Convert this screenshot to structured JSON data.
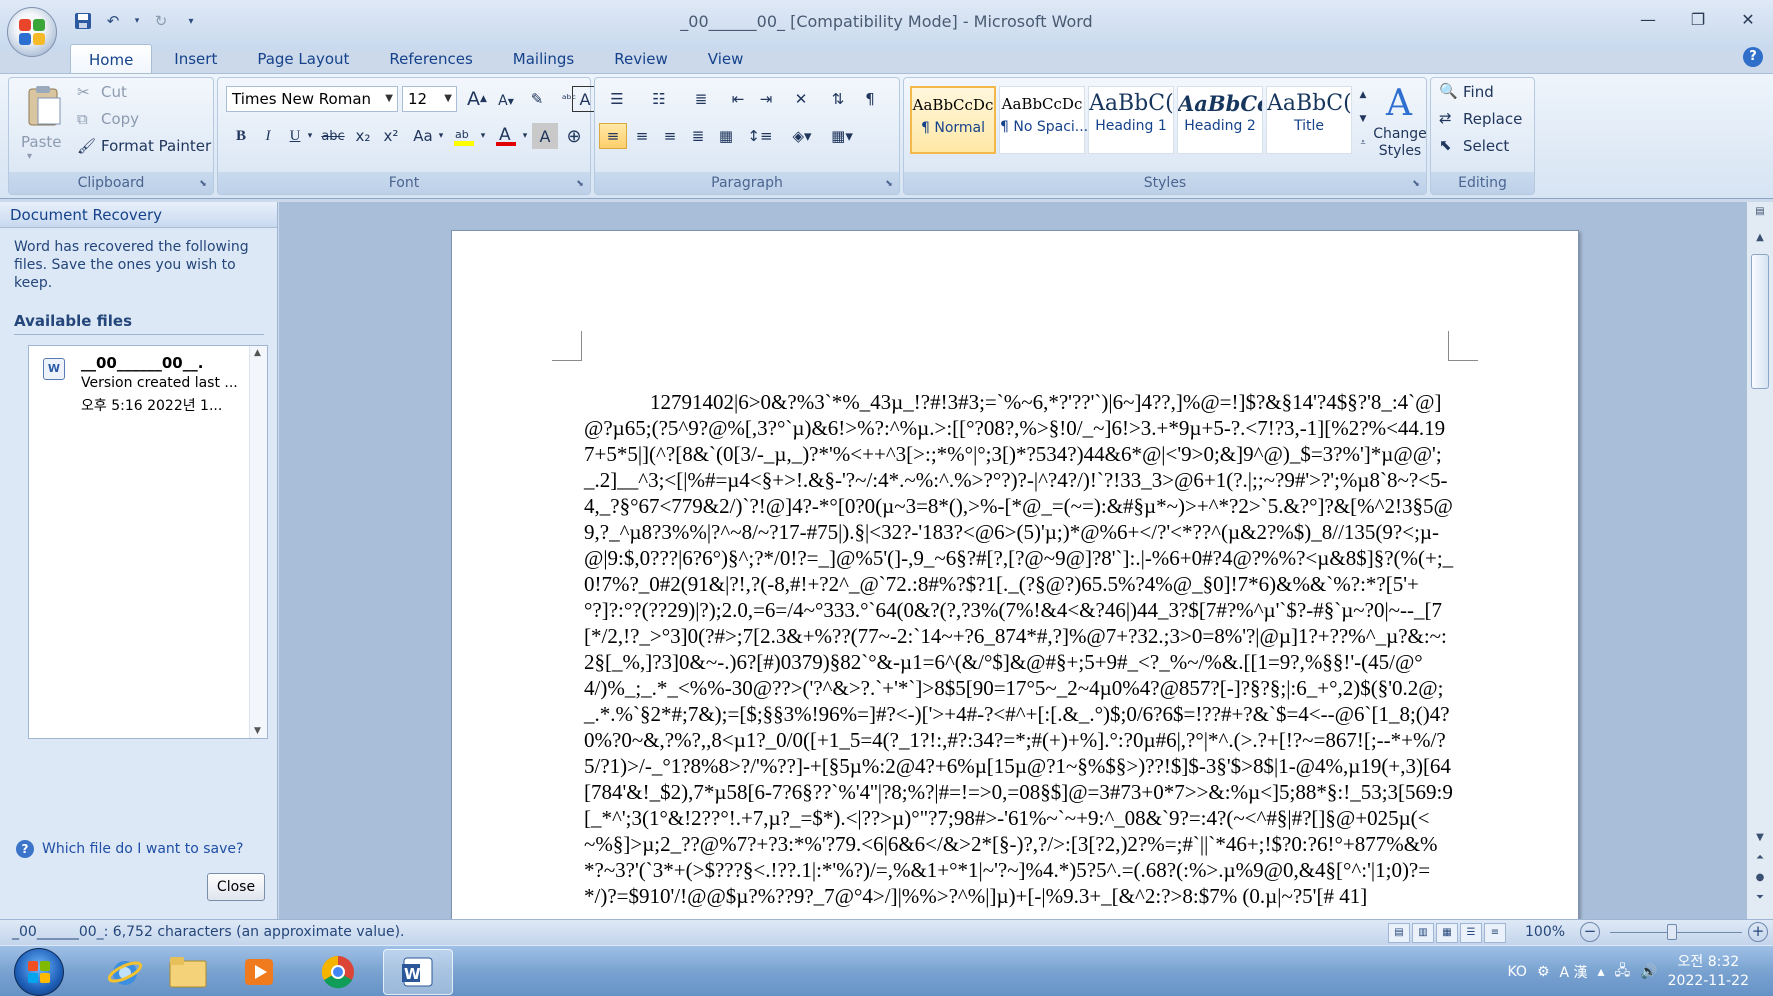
{
  "window": {
    "title": "_00______00_ [Compatibility Mode] - Microsoft Word",
    "min_icon": "minimize-icon",
    "max_icon": "restore-icon",
    "close_icon": "close-icon"
  },
  "tabs": [
    "Home",
    "Insert",
    "Page Layout",
    "References",
    "Mailings",
    "Review",
    "View"
  ],
  "clipboard": {
    "paste": "Paste",
    "cut": "Cut",
    "copy": "Copy",
    "format_painter": "Format Painter",
    "label": "Clipboard"
  },
  "font": {
    "name": "Times New Roman",
    "size": "12",
    "label": "Font",
    "bold": "B",
    "italic": "I",
    "underline": "U",
    "strike": "abc",
    "subscript": "x₂",
    "superscript": "x²",
    "case": "Aa",
    "grow": "A",
    "shrink": "A"
  },
  "paragraph": {
    "label": "Paragraph"
  },
  "styles": {
    "label": "Styles",
    "items": [
      {
        "preview": "AaBbCcDc",
        "name": "¶ Normal"
      },
      {
        "preview": "AaBbCcDc",
        "name": "¶ No Spaci..."
      },
      {
        "preview": "AaBbC(",
        "name": "Heading 1"
      },
      {
        "preview": "AaBbCc",
        "name": "Heading 2"
      },
      {
        "preview": "AaBbC(",
        "name": "Title"
      }
    ],
    "change": "Change Styles"
  },
  "editing": {
    "label": "Editing",
    "find": "Find",
    "replace": "Replace",
    "select": "Select"
  },
  "recovery": {
    "title": "Document Recovery",
    "message": "Word has recovered the following files.  Save the ones you wish to keep.",
    "available": "Available files",
    "file_name": "__00______00__.",
    "file_version": "Version created last ...",
    "file_date": "오후 5:16 2022년 1...",
    "help_link": "Which file do I want to save?",
    "close": "Close"
  },
  "document": {
    "body": "12791402|6>0&?%3`*%_43µ_!?#!3#3;=`%~6,*?'??'`)|6~]4??,]%@=!]$?&§14'?4$§?'8_:4`@]@?µ65;(?5^9?@%[,3?°`µ)&6!>%?:^%µ.>:[[°?08?,%>§!0/_~]6!>3.+*9µ+5-?.<7!?3,-1][%2?%<44.197+5*5|](^?[8&`(0[3/-_µ,_)?*'%<++^3[>:;*%°|°;3[)*?534?)44&6*@|<'9>0;&]9^@)_$=3?%']*µ@@';_.2]__^3;<[|%#=µ4<§+>!.&§-'?~/:4*.~%:^.%>?°?)?-|^?4?/)!`?!33_3>@6+1(?.|;;~?9#'>?';%µ8`8~?<5-4,_?§°67<779&2/)`?!@]4?-*°[0?0(µ~3=8*(),>%-[*@_=(~=):&#§µ*~)>+^*?2>`5.&?°]?&[%^2!3§5@9,?_^µ8?3%%|?^~8/~?17-#75|).§|<32?-'183?<@6>(5)'µ;)*@%6+</?'<*??^(µ&2?%$)_8//135(9?<;µ-@|9:$,0???|6?6°)§^;?*/0!?=_]@%5'(]-,9_~6§?#[?,[?@~9@]?8'`]:.|-%6+0#?4@?%%?<µ&8$]§?(%(+;_0!7%?_0#2(91&|?!,?(-8,#!+?2^_@`72.:8#%?$?1[._(?§@?)65.5%?4%@_§0]!7*6)&%&`%?:*?[5'+°?]?:°?(??29)|?);2.0,=6=/4~°333.°`64(0&?(?,?3%(7%!&4<&?46|)44_3?$[7#?%^µ'`$?-#§`µ~?0|~--_[7[*/2,!?_>°3]0(?#>;7[2.3&+%??(77~-2:`14~+?6_874*#,?]%@7+?32.;3>0=8%'?|@µ]1?+??%^_µ?&:~:2§[_%,]?3]0&~-.)6?[#)0379)§82`°&-µ1=6^(&/°$]&@#§+;5+9#_<?_%~/%&.[[1=9?,%§§!'-(45/@°4/)%_;_.*_<%%-30@??>('?^&>?.`+'*`]>8$5[90=17°5~_2~4µ0%4?@857?[-]?§?§;|:6_+°,2)$(§'0.2@;_.*.%`§2*#;7&);=[$;§§3%!96%=]#?<-)['>+4#-?<#^+[:[.&_.°)$;0/6?6$=!??#+?&`$=4<--@6`[1_8;()4?0%?0~&,?%?,,8<µ1?_0/0([+1_5=4(?_1?!:,#?:34?=*;#(+)+%].°:?0µ#6|,?°|*^.(>.?+[!?~=867![;--*+%/?5/?1)>/-_°1?8%8>?/'%??]-+[§5µ%:2@4?+6%µ[15µ@?1~§%$§>)??!$]$-3§'$>8$|1-@4%,µ19(+,3)[64[784'&!_$2),7*µ58[6-7?6§??`%'4''|?8;%?|#=!=>0,=08§$]@=3#73+0*7>>&:%µ<]5;88*§:!_53;3[569:9[_*^';3(1°&!2??°!.+7,µ?_=$*).<|??>µ)°\"?7;98#>-'61%~`~+9:^_08&`9?=:4?(~<^#§|#?[]§@+025µ(<~%§]>µ;2_??@%7?+?3:*%'?79.<6|6&6</&>2*[§-)?,?/>:[3[?2,)2?%=;#`||`*46+;!$?0:?6!°+877%&%*?~3?'(`3*+(>$???§<.!??.1|:*'%?)/=,%&1+°*1|~'?~]%4.*)5?5^.=(.68?(:%>.µ%9@0,&4§[°^:'|1;0)?=*/)?=$910'/!@@$µ?%??9?_7@°4>/]|%%>?^%|]µ)+[-|%9.3+_[&^2:?>8:$7% (0.µ|~?5'[# 41]"
  },
  "status": {
    "left": "_00______00_: 6,752 characters (an approximate value).",
    "zoom": "100%"
  },
  "taskbar": {
    "ime": "KO",
    "han": "A 漢",
    "time": "오전 8:32",
    "date": "2022-11-22"
  }
}
